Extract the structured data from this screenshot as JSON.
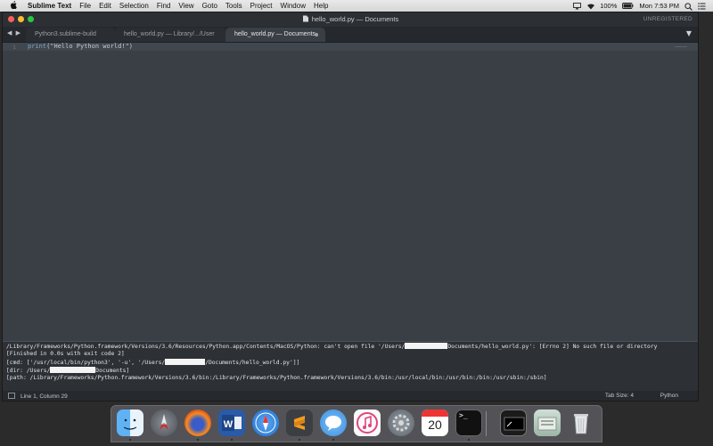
{
  "menubar": {
    "apple": "",
    "app_name": "Sublime Text",
    "items": [
      "File",
      "Edit",
      "Selection",
      "Find",
      "View",
      "Goto",
      "Tools",
      "Project",
      "Window",
      "Help"
    ],
    "battery": "100%",
    "clock": "Mon 7:53 PM"
  },
  "window": {
    "title": "hello_world.py — Documents",
    "unregistered": "UNREGISTERED",
    "nav_arrows": "◀ ▶",
    "tabs": [
      {
        "label": "Python3.sublime-build"
      },
      {
        "label": "hello_world.py — Library/.../User"
      },
      {
        "label": "hello_world.py — Documents"
      }
    ],
    "tab_dropdown": "▼"
  },
  "editor": {
    "line_number": "1",
    "code_keyword": "print",
    "code_string": "(\"Hello Python world!\")"
  },
  "output": {
    "line1_a": "/Library/Frameworks/Python.framework/Versions/3.6/Resources/Python.app/Contents/MacOS/Python: can't open file '/Users/",
    "line1_b": "Documents/hello_world.py': [Errno 2] No such file or directory",
    "line2": "[Finished in 0.0s with exit code 2]",
    "line3_a": "[cmd: ['/usr/local/bin/python3', '-u', '/Users/",
    "line3_b": "/Documents/hello_world.py']]",
    "line4_a": "[dir: /Users/",
    "line4_b": "Documents]",
    "line5": "[path: /Library/Frameworks/Python.framework/Versions/3.6/bin:/Library/Frameworks/Python.framework/Versions/3.6/bin:/usr/local/bin:/usr/bin:/bin:/usr/sbin:/sbin]"
  },
  "statusbar": {
    "position": "Line 1, Column 29",
    "tab_size": "Tab Size: 4",
    "syntax": "Python"
  },
  "dock": {
    "calendar_day": "20",
    "terminal_prompt": ">_"
  },
  "colors": {
    "editor_bg": "#3a3f46",
    "output_bg": "#2d3136",
    "menubar_bg": "#e0e0e0"
  }
}
